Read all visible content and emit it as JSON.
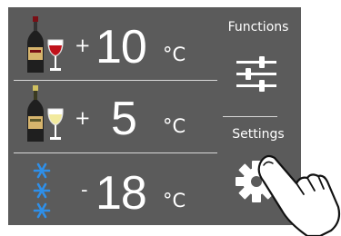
{
  "zones": [
    {
      "sign": "+",
      "value": "10",
      "unit": "°C",
      "icon": "red-wine-bottle-and-glass-icon"
    },
    {
      "sign": "+",
      "value": "5",
      "unit": "°C",
      "icon": "white-wine-bottle-and-glass-icon"
    },
    {
      "sign": "-",
      "value": "18",
      "unit": "°C",
      "icon": "snowflakes-icon"
    }
  ],
  "side": {
    "functions_label": "Functions",
    "settings_label": "Settings",
    "functions_icon": "sliders-icon",
    "settings_icon": "gear-icon"
  },
  "colors": {
    "panel": "#5b5b5b",
    "text": "#ffffff",
    "snow": "#2f8fe8",
    "red_wine": "#c0121b",
    "white_wine": "#f2ea9e"
  },
  "overlay": {
    "icon": "pointing-finger-icon"
  }
}
